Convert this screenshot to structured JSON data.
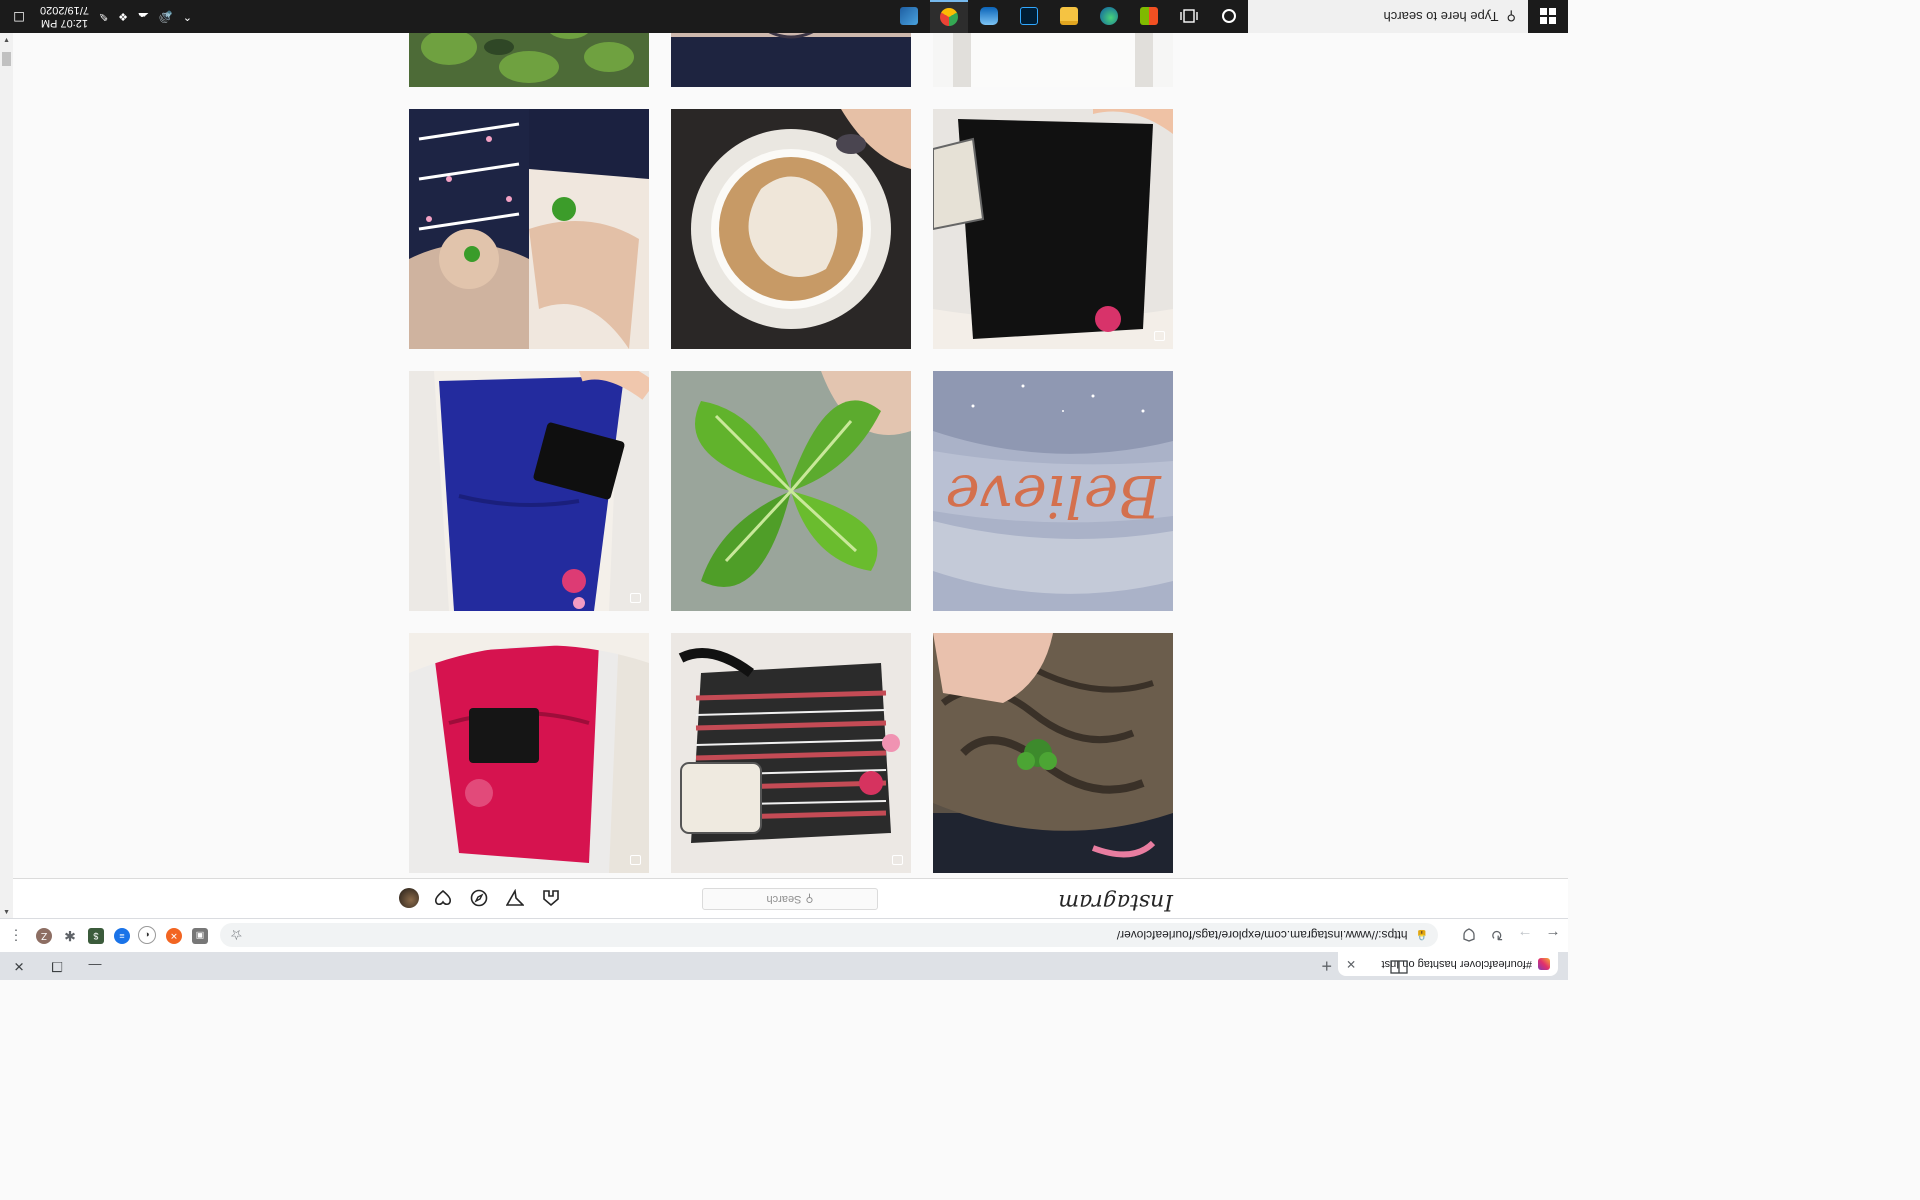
{
  "browser": {
    "tab_title": "#fourleafclover hashtag on Inst",
    "tab_close": "✕",
    "new_tab": "+",
    "back": "←",
    "forward": "→",
    "reload": "↻",
    "url": "https://www.instagram.com/explore/tags/fourleafclover/",
    "window_minimize": "—",
    "window_restore": "❐",
    "window_close": "✕",
    "extension_profile_letter": "Z"
  },
  "instagram": {
    "logo": "Instagram",
    "search_placeholder": "Search",
    "nav_icons": [
      "home-icon",
      "direct-icon",
      "explore-icon",
      "activity-icon",
      "profile-avatar"
    ]
  },
  "grid": {
    "rows": [
      [
        "cat-with-clover",
        "patterned-dress-flatlay",
        "pink-dress-flatlay"
      ],
      [
        "believe-lettering",
        "four-leaf-clover-closeup",
        "blue-dress-flatlay"
      ],
      [
        "black-dress-flatlay",
        "latte-art-cup",
        "child-with-clover-collage"
      ],
      [
        "picture-frame",
        "tattoo",
        "clover-leaves"
      ]
    ],
    "believe_text": "Believe"
  },
  "taskbar": {
    "search_placeholder": "Type here to search",
    "time": "12:07 PM",
    "date": "7/19/2020",
    "apps": [
      "task-view",
      "microsoft-store",
      "edge",
      "file-explorer",
      "photoshop",
      "onedrive",
      "chrome",
      "control-panel"
    ]
  },
  "colors": {
    "accent": "#0095f6",
    "taskbar_bg": "#1b1b1b",
    "chrome_bg": "#dee1e6"
  }
}
